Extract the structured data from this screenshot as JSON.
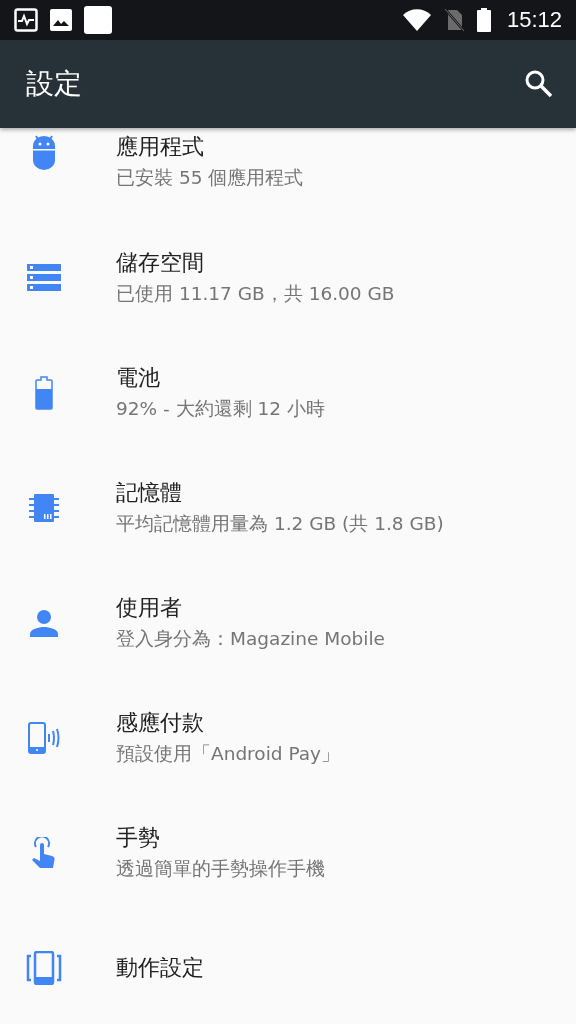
{
  "status_bar": {
    "time": "15:12"
  },
  "app_bar": {
    "title": "設定"
  },
  "items": [
    {
      "kind": "apps",
      "title": "應用程式",
      "summary": "已安裝 55 個應用程式"
    },
    {
      "kind": "storage",
      "title": "儲存空間",
      "summary": "已使用 11.17 GB，共 16.00 GB"
    },
    {
      "kind": "battery",
      "title": "電池",
      "summary": "92% - 大約還剩 12 小時"
    },
    {
      "kind": "memory",
      "title": "記憶體",
      "summary": "平均記憶體用量為 1.2 GB (共 1.8 GB)"
    },
    {
      "kind": "user",
      "title": "使用者",
      "summary": "登入身分為：Magazine Mobile"
    },
    {
      "kind": "payment",
      "title": "感應付款",
      "summary": "預設使用「Android Pay」"
    },
    {
      "kind": "gesture",
      "title": "手勢",
      "summary": "透過簡單的手勢操作手機"
    },
    {
      "kind": "motion",
      "title": "動作設定"
    }
  ]
}
